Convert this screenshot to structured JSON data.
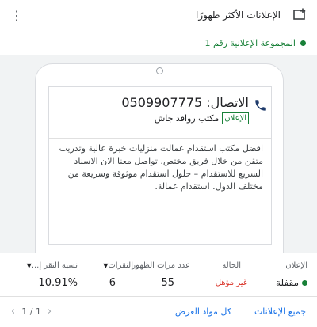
{
  "header": {
    "title": "الإعلانات الأكثر ظهورًا",
    "add_icon": "add-to-queue-icon",
    "menu_icon": "more-vert-icon"
  },
  "group": {
    "name": "المجموعة الإعلانية رقم 1",
    "status_color": "#188038"
  },
  "ad": {
    "phone_icon": "phone-icon",
    "call_label": "الاتصال: 0509907775",
    "badge": "الإعلان",
    "business_name": "مكتب روافد جاش",
    "description": "افضل مكتب استقدام عمالت منزليات خبرة عالية وتدريب متقن من خلال فريق مختص. تواصل معنا الان الاسناد السريع للاستقدام – حلول استقدام موثوقة وسريعة من مختلف الدول. استقدام عمالة."
  },
  "stats": {
    "columns": [
      {
        "label": "الإعلان",
        "value": "مقفلة"
      },
      {
        "label": "الحالة",
        "value": "غير مؤهل"
      },
      {
        "label": "عدد مرات الظهور",
        "value": "55"
      },
      {
        "label": "النقرات",
        "value": "6"
      },
      {
        "label": "نسبة النقر إ...",
        "value": "10.91%"
      }
    ]
  },
  "footer": {
    "all_ads": "جميع الإعلانات",
    "all_assets": "كل مواد العرض",
    "pagination": "1 / 1"
  },
  "colors": {
    "accent": "#1a73e8",
    "enabled_green": "#188038",
    "ineligible_red": "#d93025"
  }
}
